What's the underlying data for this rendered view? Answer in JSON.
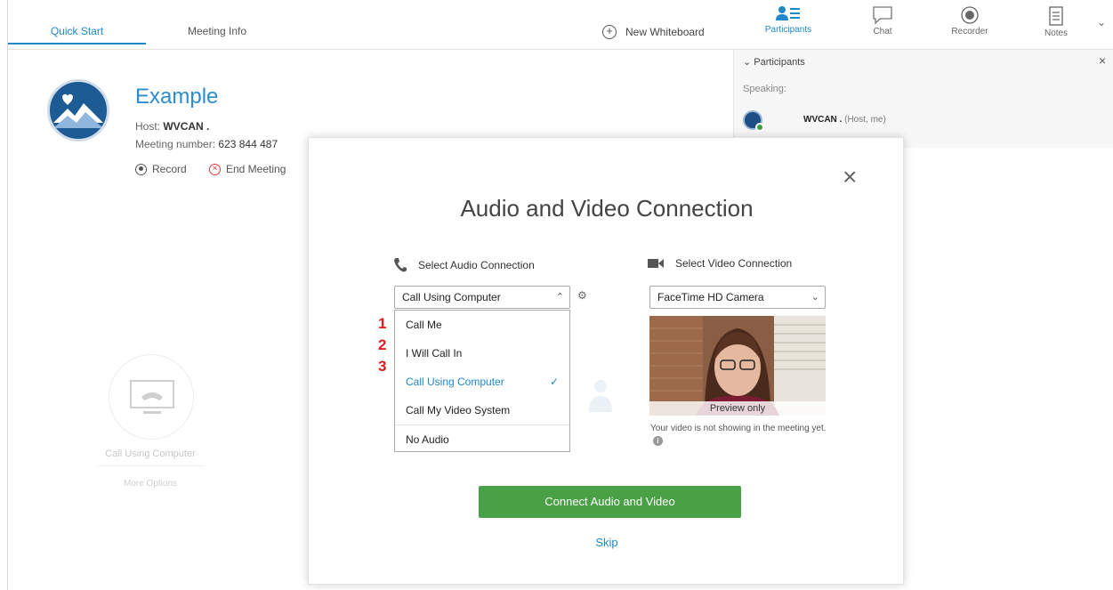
{
  "tabs": {
    "quick_start": "Quick Start",
    "meeting_info": "Meeting Info"
  },
  "toolbar": {
    "new_whiteboard": "New Whiteboard",
    "participants": "Participants",
    "chat": "Chat",
    "recorder": "Recorder",
    "notes": "Notes"
  },
  "participants_panel": {
    "header": "Participants",
    "speaking_label": "Speaking:",
    "participant_name": "WVCAN .",
    "participant_role": "(Host, me)"
  },
  "meeting": {
    "title": "Example",
    "host_label": "Host:",
    "host_name": "WVCAN .",
    "number_label": "Meeting number:",
    "number": "623 844 487",
    "record_label": "Record",
    "end_meeting_label": "End Meeting"
  },
  "call_panel": {
    "label": "Call Using Computer",
    "more_options": "More Options"
  },
  "modal": {
    "title": "Audio and Video Connection",
    "audio_label": "Select Audio Connection",
    "video_label": "Select Video Connection",
    "audio_selected": "Call Using Computer",
    "audio_options": [
      "Call Me",
      "I Will Call In",
      "Call Using Computer",
      "Call My Video System",
      "No Audio"
    ],
    "video_selected": "FaceTime HD Camera",
    "preview_label": "Preview only",
    "preview_note": "Your video is not showing in the meeting yet.",
    "connect_button": "Connect Audio and Video",
    "skip_link": "Skip"
  },
  "annotations": [
    "1",
    "2",
    "3"
  ],
  "colors": {
    "accent_blue": "#1e88c8",
    "connect_green": "#49a045",
    "annotation_red": "#e01b1b"
  }
}
